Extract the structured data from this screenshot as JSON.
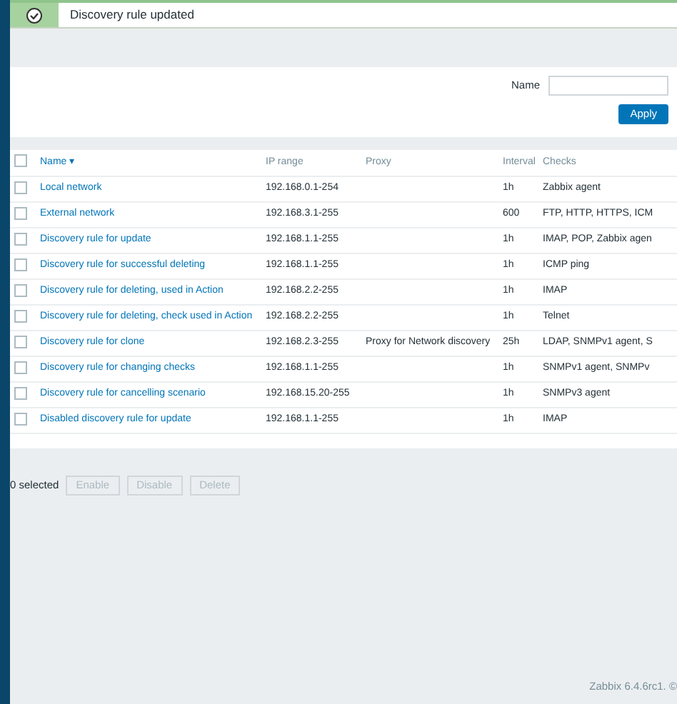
{
  "message": {
    "text": "Discovery rule updated"
  },
  "filter": {
    "label": "Name",
    "button": "Apply"
  },
  "table": {
    "all_checked": false,
    "columns": [
      {
        "label": "Name",
        "sorted": true,
        "sort_indicator": "▾"
      },
      {
        "label": "IP range",
        "sorted": false
      },
      {
        "label": "Proxy",
        "sorted": false
      },
      {
        "label": "Interval",
        "sorted": false
      },
      {
        "label": "Checks",
        "sorted": false
      }
    ],
    "rows": [
      {
        "name": "Local network",
        "ip": "192.168.0.1-254",
        "proxy": "",
        "interval": "1h",
        "checks": "Zabbix agent",
        "checked": false
      },
      {
        "name": "External network",
        "ip": "192.168.3.1-255",
        "proxy": "",
        "interval": "600",
        "checks": "FTP, HTTP, HTTPS, ICM",
        "checked": false
      },
      {
        "name": "Discovery rule for update",
        "ip": "192.168.1.1-255",
        "proxy": "",
        "interval": "1h",
        "checks": "IMAP, POP, Zabbix agen",
        "checked": false
      },
      {
        "name": "Discovery rule for successful deleting",
        "ip": "192.168.1.1-255",
        "proxy": "",
        "interval": "1h",
        "checks": "ICMP ping",
        "checked": false
      },
      {
        "name": "Discovery rule for deleting, used in Action",
        "ip": "192.168.2.2-255",
        "proxy": "",
        "interval": "1h",
        "checks": "IMAP",
        "checked": false
      },
      {
        "name": "Discovery rule for deleting, check used in Action",
        "ip": "192.168.2.2-255",
        "proxy": "",
        "interval": "1h",
        "checks": "Telnet",
        "checked": false
      },
      {
        "name": "Discovery rule for clone",
        "ip": "192.168.2.3-255",
        "proxy": "Proxy for Network discovery",
        "interval": "25h",
        "checks": "LDAP, SNMPv1 agent, S",
        "checked": false
      },
      {
        "name": "Discovery rule for changing checks",
        "ip": "192.168.1.1-255",
        "proxy": "",
        "interval": "1h",
        "checks": "SNMPv1 agent, SNMPv",
        "checked": false
      },
      {
        "name": "Discovery rule for cancelling scenario",
        "ip": "192.168.15.20-255",
        "proxy": "",
        "interval": "1h",
        "checks": "SNMPv3 agent",
        "checked": false
      },
      {
        "name": "Disabled discovery rule for update",
        "ip": "192.168.1.1-255",
        "proxy": "",
        "interval": "1h",
        "checks": "IMAP",
        "checked": false
      }
    ]
  },
  "actions": {
    "selected_count": "0 selected",
    "buttons": [
      {
        "label": "Enable",
        "disabled": true
      },
      {
        "label": "Disable",
        "disabled": true
      },
      {
        "label": "Delete",
        "disabled": true
      }
    ]
  },
  "footer": "Zabbix 6.4.6rc1. ©"
}
